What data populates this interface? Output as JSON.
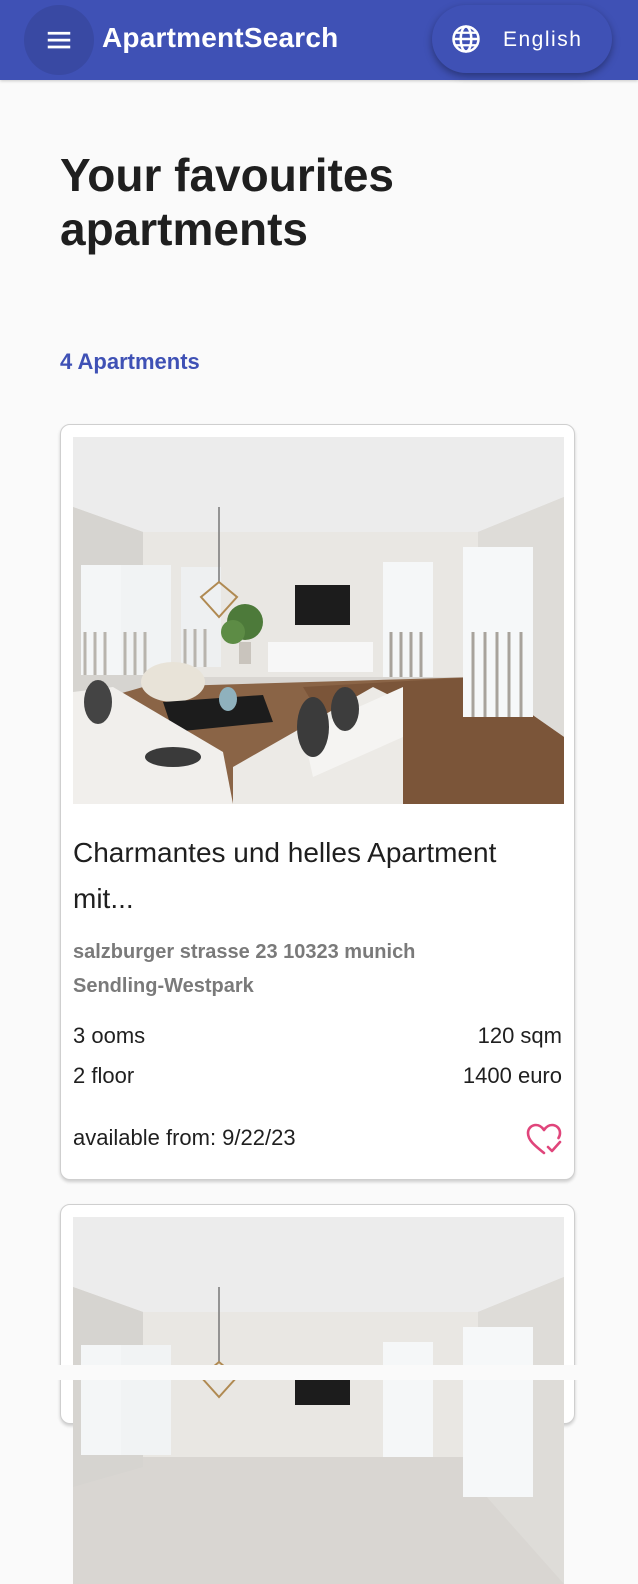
{
  "appbar": {
    "title": "ApartmentSearch",
    "menu_icon": "menu-icon",
    "language": {
      "icon": "globe-icon",
      "label": "English"
    }
  },
  "page": {
    "title": "Your favourites apartments",
    "count_label": "4 Apartments"
  },
  "colors": {
    "primary": "#3f51b5",
    "favourite": "#e0457b",
    "muted_text": "#7a7a7a"
  },
  "listings": [
    {
      "title": "Charmantes und helles Apartment mit...",
      "address_line1": "salzburger strasse 23 10323 munich",
      "address_line2": "Sendling-Westpark",
      "rooms": "3 ooms",
      "size": "120 sqm",
      "floor": "2 floor",
      "price": "1400 euro",
      "available": "available from: 9/22/23",
      "favourite_icon": "heart-check-icon"
    },
    {
      "photo_only": true
    }
  ]
}
